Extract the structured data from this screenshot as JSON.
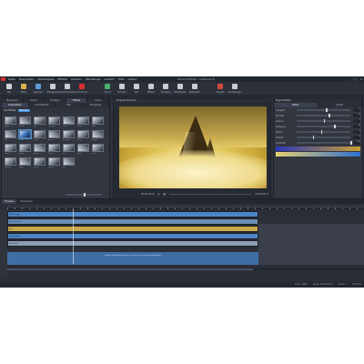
{
  "app": {
    "menu": [
      "Datei",
      "Bearbeiten",
      "Wiedergabe",
      "Effekte",
      "Dateien",
      "Werkzeuge",
      "Ansicht",
      "Hilfe",
      "Online"
    ],
    "window_title": "Movie Edit Pro - Unbenannt",
    "window_controls": [
      "_",
      "□",
      "×"
    ]
  },
  "toolbar": [
    {
      "label": "Neu",
      "icon": "new-icon",
      "color": "#d0d4da"
    },
    {
      "label": "Öffnen",
      "icon": "open-icon",
      "color": "#d9b44a"
    },
    {
      "label": "Speichern",
      "icon": "save-icon",
      "color": "#5a9ad6"
    },
    {
      "label": "Rückgängig",
      "icon": "undo-icon",
      "color": "#c8ccd4"
    },
    {
      "label": "Wiederherstellen",
      "icon": "redo-icon",
      "color": "#c8ccd4"
    },
    {
      "label": "Aufnehmen",
      "icon": "record-icon",
      "color": "#d8302c"
    },
    {
      "label": "Import",
      "icon": "import-icon",
      "color": "#4caf6a"
    },
    {
      "label": "Trimmen",
      "icon": "trim-icon",
      "color": "#c8ccd4"
    },
    {
      "label": "Text",
      "icon": "text-icon",
      "color": "#c8ccd4"
    },
    {
      "label": "Effekte",
      "icon": "effects-icon",
      "color": "#c8ccd4"
    },
    {
      "label": "Übergang",
      "icon": "transition-icon",
      "color": "#c8ccd4"
    },
    {
      "label": "Stabilisieren",
      "icon": "stabilize-icon",
      "color": "#c8ccd4"
    },
    {
      "label": "Bearbeiten",
      "icon": "edit-icon",
      "color": "#c8ccd4"
    },
    {
      "label": "Ausgabe",
      "icon": "export-icon",
      "color": "#d04a3a"
    },
    {
      "label": "Einstellungen",
      "icon": "settings-icon",
      "color": "#c8ccd4"
    }
  ],
  "left_panel": {
    "tabs": [
      "Mediapool",
      "Import",
      "Vorlagen",
      "Effekte",
      "Audio"
    ],
    "active_tab": 3,
    "sub_tabs": [
      "Videoeffekte",
      "Audioeffekte",
      "Titel",
      "Übergänge"
    ],
    "category": "Alle Effekte",
    "category_chip": "Blenden",
    "thumbnails": [
      "Alpha",
      "Blende",
      "Blur",
      "Chroma",
      "Color",
      "Crop",
      "Fade",
      "Flip",
      "Glow",
      "Grain",
      "Invert",
      "Kontrast",
      "Mirror",
      "Mosaik",
      "Noise",
      "Ripple",
      "Rotate",
      "Sepia",
      "Shift",
      "Solar",
      "Twist",
      "Vignette",
      "Warp",
      "Zoom",
      "Zoom 2",
      "Pan"
    ],
    "footer": "Effekte: 26"
  },
  "monitor": {
    "title": "Programmmonitor",
    "time_start": "00:00:00:00",
    "time_end": "00:00:28:12"
  },
  "right_panel": {
    "title": "Eigenschaften",
    "tabs": [
      "Effekt",
      "Objekt"
    ],
    "rows": [
      {
        "key": "Helligkeit",
        "pos": 0.55,
        "val": "0"
      },
      {
        "key": "Kontrast",
        "pos": 0.6,
        "val": "12"
      },
      {
        "key": "Gamma",
        "pos": 0.5,
        "val": "0"
      },
      {
        "key": "Sättigung",
        "pos": 0.7,
        "val": "24"
      },
      {
        "key": "Farbton",
        "pos": 0.45,
        "val": "0"
      },
      {
        "key": "Schärfe",
        "pos": 0.3,
        "val": "8"
      },
      {
        "key": "Deckkraft",
        "pos": 1.0,
        "val": "100"
      }
    ],
    "gradient_colors": [
      "#2a37b5",
      "#c8a035",
      "#e8d070",
      "#2e6fd0"
    ]
  },
  "timeline": {
    "tabs": [
      "Timeline",
      "Storyboard"
    ],
    "active_tab": 0,
    "clips": [
      {
        "name": "Clip_01.mp4",
        "type": "v"
      },
      {
        "name": "Audio_01.wav",
        "type": "a"
      },
      {
        "name": "Titel",
        "type": "y"
      },
      {
        "name": "Clip_02.mp4",
        "type": "v"
      },
      {
        "name": "Musik.mp3",
        "type": "l"
      }
    ],
    "drop_text": "Ziehen Sie Dateien hierher, um sie zur Timeline hinzuzufügen"
  },
  "status": {
    "items": [
      "Zoom: 100%",
      "Dauer: 00:00:28:12",
      "Frame: 0",
      "CPU 12%"
    ]
  }
}
